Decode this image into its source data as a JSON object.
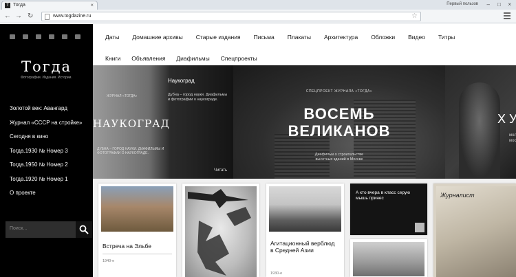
{
  "browser": {
    "tab_title": "Тогда",
    "favicon_letter": "T",
    "url": "www.togdazine.ru",
    "user_label": "Первый пользов"
  },
  "sidebar": {
    "logo": "Тогда",
    "tagline": "Фотографии. Издания. Истории.",
    "social_icons": [
      "instagram-icon",
      "photo-icon",
      "vk-icon",
      "twitter-icon",
      "facebook-icon",
      "mail-icon"
    ],
    "items": [
      {
        "label": "Золотой век: Авангард"
      },
      {
        "label": "Журнал «СССР на стройке»"
      },
      {
        "label": "Сегодня в кино"
      },
      {
        "label": "Тогда.1930 № Номер 3"
      },
      {
        "label": "Тогда.1950 № Номер 2"
      },
      {
        "label": "Тогда.1920 № Номер 1"
      },
      {
        "label": "О проекте"
      }
    ],
    "search_placeholder": "Поиск..."
  },
  "nav": {
    "row1": [
      "Даты",
      "Домашние архивы",
      "Старые издания",
      "Письма",
      "Плакаты",
      "Архитектура",
      "Обложки",
      "Видео",
      "Титры"
    ],
    "row2": [
      "Книги",
      "Объявления",
      "Диафильмы",
      "Спецпроекты"
    ]
  },
  "slider": {
    "slide1": {
      "journal": "ЖУРНАЛ «ТОГДА»",
      "big": "НАУКОГРАД",
      "sub": "ДУБНА – ГОРОД НАУКИ. ДИАФИЛЬМЫ И ФОТОГРАФИИ О НАУКОГРАДЕ.",
      "title": "Наукоград",
      "desc": "Дубна – город науки. Диафильмы и фотографии о наукограде.",
      "read": "Читать"
    },
    "slide2": {
      "label": "СПЕЦПРОЕКТ ЖУРНАЛА «ТОГДА»",
      "big_line1": "ВОСЕМЬ",
      "big_line2": "ВЕЛИКАНОВ",
      "sub_line1": "Диафильм о строительстве",
      "sub_line2": "высотных зданий в Москве"
    },
    "slide3": {
      "big": "Х У",
      "sub": "моло\nмос"
    }
  },
  "cards": [
    {
      "title": "Встреча на Эльбе",
      "year": "1940-е"
    },
    {
      "title": "",
      "year": ""
    },
    {
      "title": "Агитационный верблюд в Средней Азии",
      "year": "1930-е"
    },
    {
      "title": "А кто вчера в класс серую мышь принес",
      "year": ""
    },
    {
      "title": "Журналист",
      "year": ""
    }
  ],
  "colors": {
    "sidebar_bg": "#000000",
    "search_bg": "#2e2e2e"
  }
}
